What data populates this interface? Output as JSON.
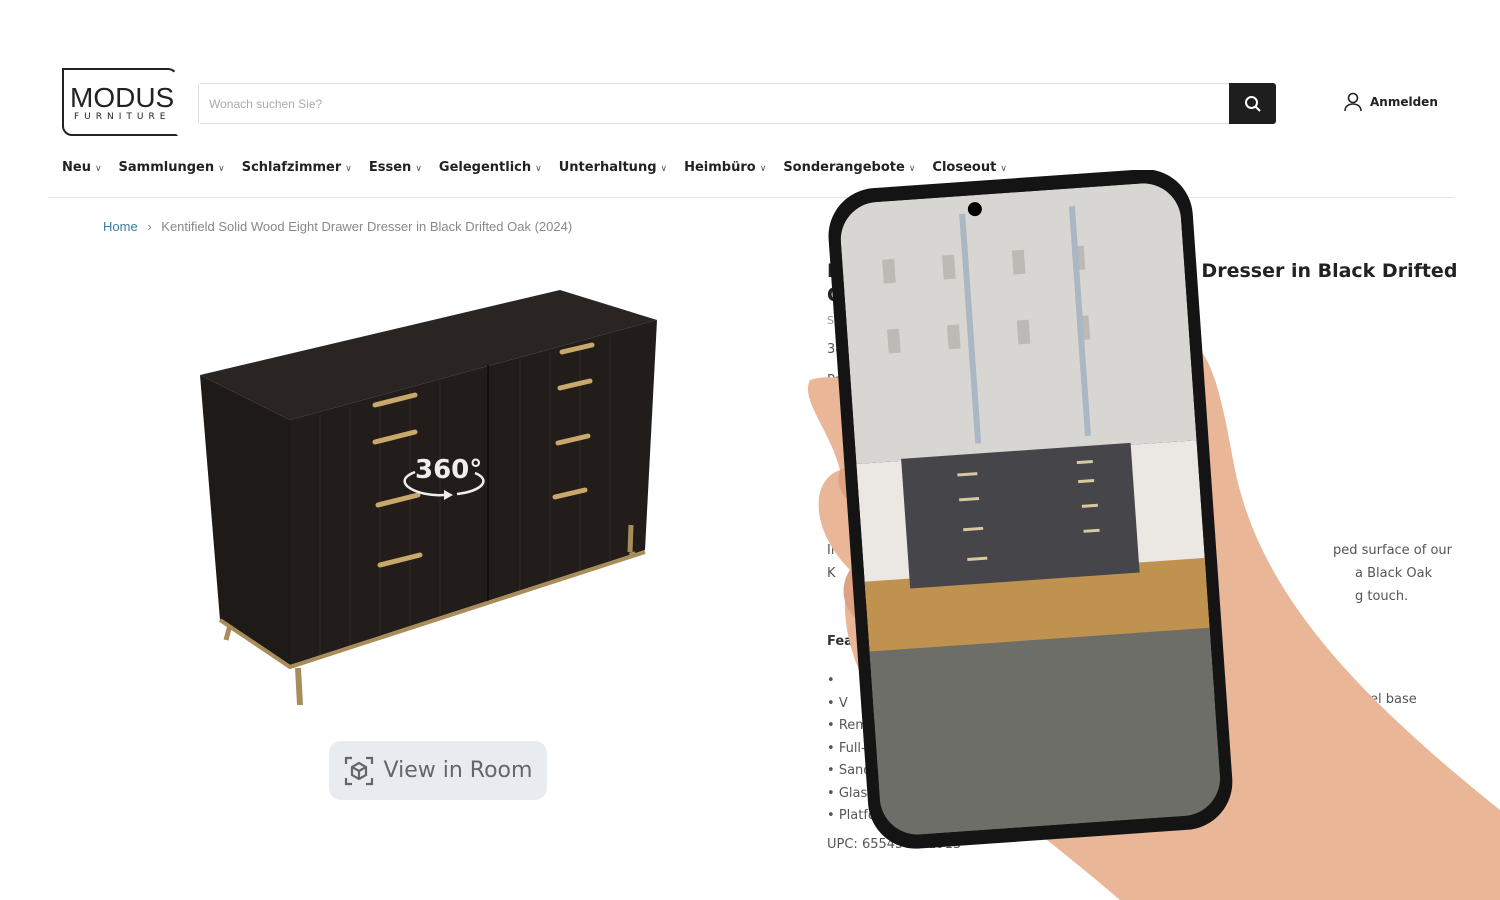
{
  "header": {
    "logo_main": "MODUS",
    "logo_sub": "FURNITURE",
    "search_placeholder": "Wonach suchen Sie?",
    "login_label": "Anmelden"
  },
  "nav": [
    "Neu",
    "Sammlungen",
    "Schlafzimmer",
    "Essen",
    "Gelegentlich",
    "Unterhaltung",
    "Heimbüro",
    "Sonderangebote",
    "Closeout"
  ],
  "breadcrumb": {
    "home": "Home",
    "separator": "›",
    "current": "Kentifield Solid Wood Eight Drawer Dresser in Black Drifted Oak (2024)"
  },
  "viewer": {
    "badge": "360°",
    "view_in_room": "View in Room"
  },
  "product_visible_fragments": {
    "title_line1_left": "Ke",
    "title_line1_right": "wer Dresser in Black Drifted",
    "title_line2_left": "Oa",
    "sku": "SKU",
    "dims": "38H",
    "part": "Part",
    "desc_left": [
      "Inspired",
      "K"
    ],
    "desc_right": [
      "ped surface of our",
      "a Black Oak",
      "g touch."
    ],
    "features_heading": "Featu",
    "features": [
      "",
      "V",
      "Remov",
      "Full-exte",
      "Sanded a",
      "Glass mir",
      "Platform I"
    ],
    "feature_right": "el base",
    "upc": "UPC: 655450431913"
  }
}
